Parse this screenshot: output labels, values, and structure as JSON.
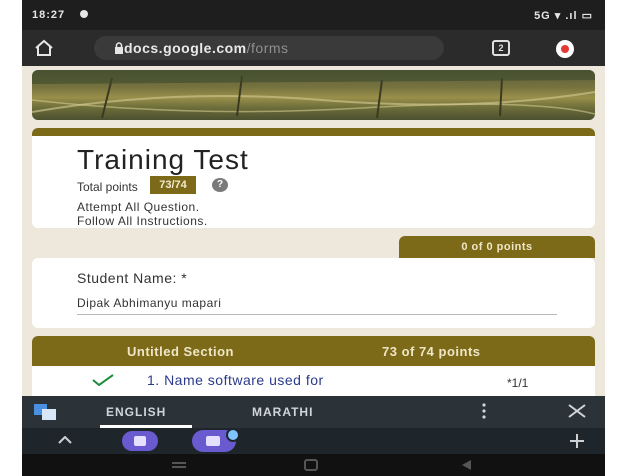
{
  "status_bar": {
    "time": "18:27",
    "right_indicators": "5G ▾ .ıl ▭"
  },
  "browser": {
    "url_domain": "docs.google.com",
    "url_path": "/forms",
    "tabs_count": "2"
  },
  "form": {
    "title": "Training Test",
    "total_points_label": "Total points",
    "total_points_value": "73/74",
    "help_symbol": "?",
    "description_line1": "Attempt All Question.",
    "description_line2": "Follow All Instructions.",
    "name_section_points": "0 of 0 points",
    "student_name_label": "Student Name: *",
    "student_name_value": "Dipak Abhimanyu mapari",
    "section_title": "Untitled Section",
    "section_points": "73 of 74 points",
    "question_text": "1. Name software used for",
    "question_score": "*1/1"
  },
  "keyboard": {
    "lang_active": "ENGLISH",
    "lang_other": "MARATHI"
  },
  "colors": {
    "accent": "#7c6a18",
    "question_text": "#2a3a8c",
    "keyboard_bg": "#2b3238"
  },
  "icons": [
    "home-icon",
    "lock-icon",
    "tabs-icon",
    "menu-icon",
    "help-icon",
    "check-icon",
    "translate-icon",
    "more-icon",
    "close-icon",
    "collapse-icon",
    "add-icon"
  ]
}
